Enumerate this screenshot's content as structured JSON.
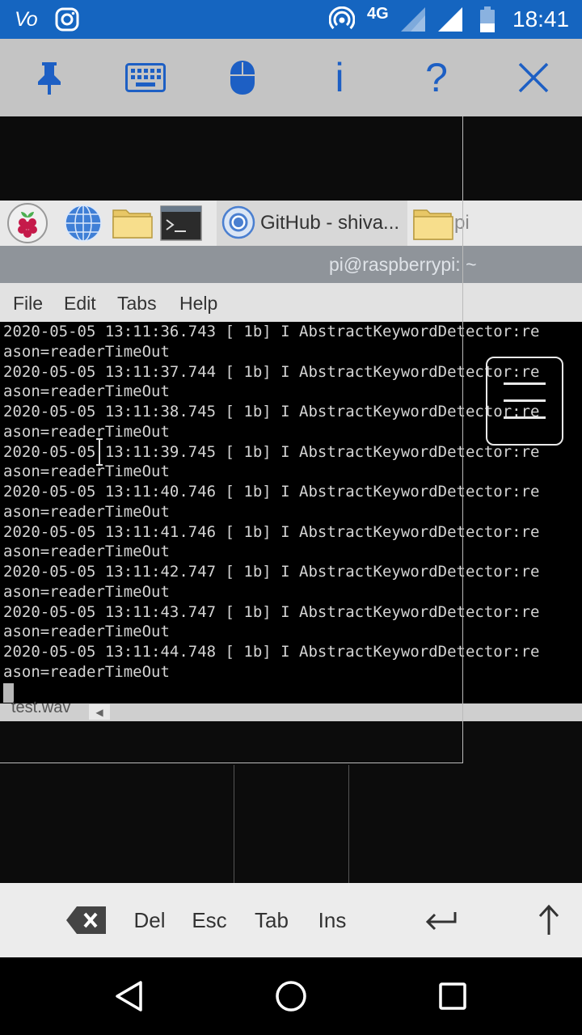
{
  "status_bar": {
    "volte_label": "Vo",
    "network_type": "4G",
    "time": "18:41",
    "icons": [
      "volte-icon",
      "instagram-icon",
      "hotspot-icon",
      "signal-icon",
      "signal-icon",
      "battery-icon"
    ]
  },
  "vnc_toolbar": {
    "info_label": "i",
    "help_label": "?",
    "icons": [
      "pin-icon",
      "keyboard-icon",
      "mouse-icon",
      "close-icon"
    ]
  },
  "taskbar": {
    "chrome_window_label": "GitHub - shiva...",
    "folder_window_label": "pi",
    "icons": [
      "raspberry-icon",
      "globe-icon",
      "folder-icon",
      "terminal-icon",
      "chrome-icon",
      "folder-icon"
    ]
  },
  "terminal": {
    "title": "pi@raspberrypi: ~",
    "menu": [
      "File",
      "Edit",
      "Tabs",
      "Help"
    ],
    "lines": [
      "2020-05-05 13:11:36.743 [ 1b] I AbstractKeywordDetector:re",
      "ason=readerTimeOut",
      "2020-05-05 13:11:37.744 [ 1b] I AbstractKeywordDetector:re",
      "ason=readerTimeOut",
      "2020-05-05 13:11:38.745 [ 1b] I AbstractKeywordDetector:re",
      "ason=readerTimeOut",
      "2020-05-05 13:11:39.745 [ 1b] I AbstractKeywordDetector:re",
      "ason=readerTimeOut",
      "2020-05-05 13:11:40.746 [ 1b] I AbstractKeywordDetector:re",
      "ason=readerTimeOut",
      "2020-05-05 13:11:41.746 [ 1b] I AbstractKeywordDetector:re",
      "ason=readerTimeOut",
      "2020-05-05 13:11:42.747 [ 1b] I AbstractKeywordDetector:re",
      "ason=readerTimeOut",
      "2020-05-05 13:11:43.747 [ 1b] I AbstractKeywordDetector:re",
      "ason=readerTimeOut",
      "2020-05-05 13:11:44.748 [ 1b] I AbstractKeywordDetector:re",
      "ason=readerTimeOut"
    ]
  },
  "file_manager": {
    "partial_filename": "test.wav"
  },
  "special_keys": {
    "labels": [
      "Del",
      "Esc",
      "Tab",
      "Ins"
    ],
    "icons": [
      "backspace-icon",
      "enter-icon",
      "shift-up-icon"
    ]
  },
  "nav_bar": {
    "icons": [
      "back-icon",
      "home-icon",
      "recents-icon"
    ]
  },
  "colors": {
    "status_bar": "#1565c0",
    "toolbar_bg": "#c4c4c4",
    "toolbar_icon": "#1d5fc4",
    "terminal_bg": "#000000",
    "terminal_text": "#d4d4d4"
  }
}
